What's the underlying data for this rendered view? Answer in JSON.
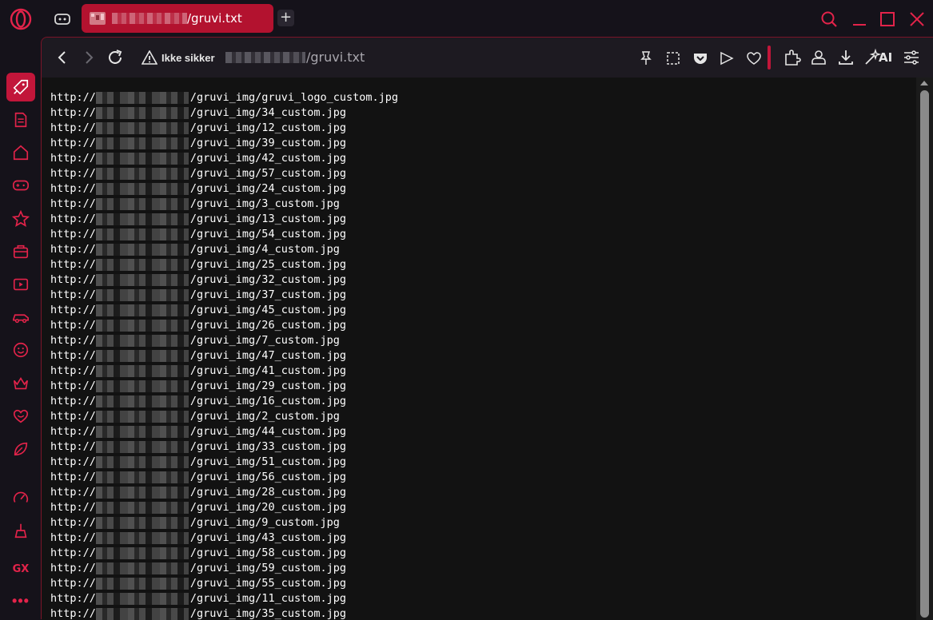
{
  "browser": {
    "tab_title": "/gruvi.txt",
    "new_tab_label": "+",
    "security_label": "Ikke sikker",
    "url_path": "/gruvi.txt",
    "ai_label": "AI",
    "accent_color": "#c2163a",
    "sidebar_gx_label": "GX",
    "sidebar_more_label": "•••"
  },
  "content": {
    "line_prefix": "http://",
    "lines": [
      "/gruvi_img/gruvi_logo_custom.jpg",
      "/gruvi_img/34_custom.jpg",
      "/gruvi_img/12_custom.jpg",
      "/gruvi_img/39_custom.jpg",
      "/gruvi_img/42_custom.jpg",
      "/gruvi_img/57_custom.jpg",
      "/gruvi_img/24_custom.jpg",
      "/gruvi_img/3_custom.jpg",
      "/gruvi_img/13_custom.jpg",
      "/gruvi_img/54_custom.jpg",
      "/gruvi_img/4_custom.jpg",
      "/gruvi_img/25_custom.jpg",
      "/gruvi_img/32_custom.jpg",
      "/gruvi_img/37_custom.jpg",
      "/gruvi_img/45_custom.jpg",
      "/gruvi_img/26_custom.jpg",
      "/gruvi_img/7_custom.jpg",
      "/gruvi_img/47_custom.jpg",
      "/gruvi_img/41_custom.jpg",
      "/gruvi_img/29_custom.jpg",
      "/gruvi_img/16_custom.jpg",
      "/gruvi_img/2_custom.jpg",
      "/gruvi_img/44_custom.jpg",
      "/gruvi_img/33_custom.jpg",
      "/gruvi_img/51_custom.jpg",
      "/gruvi_img/56_custom.jpg",
      "/gruvi_img/28_custom.jpg",
      "/gruvi_img/20_custom.jpg",
      "/gruvi_img/9_custom.jpg",
      "/gruvi_img/43_custom.jpg",
      "/gruvi_img/58_custom.jpg",
      "/gruvi_img/59_custom.jpg",
      "/gruvi_img/55_custom.jpg",
      "/gruvi_img/11_custom.jpg",
      "/gruvi_img/35_custom.jpg"
    ]
  }
}
